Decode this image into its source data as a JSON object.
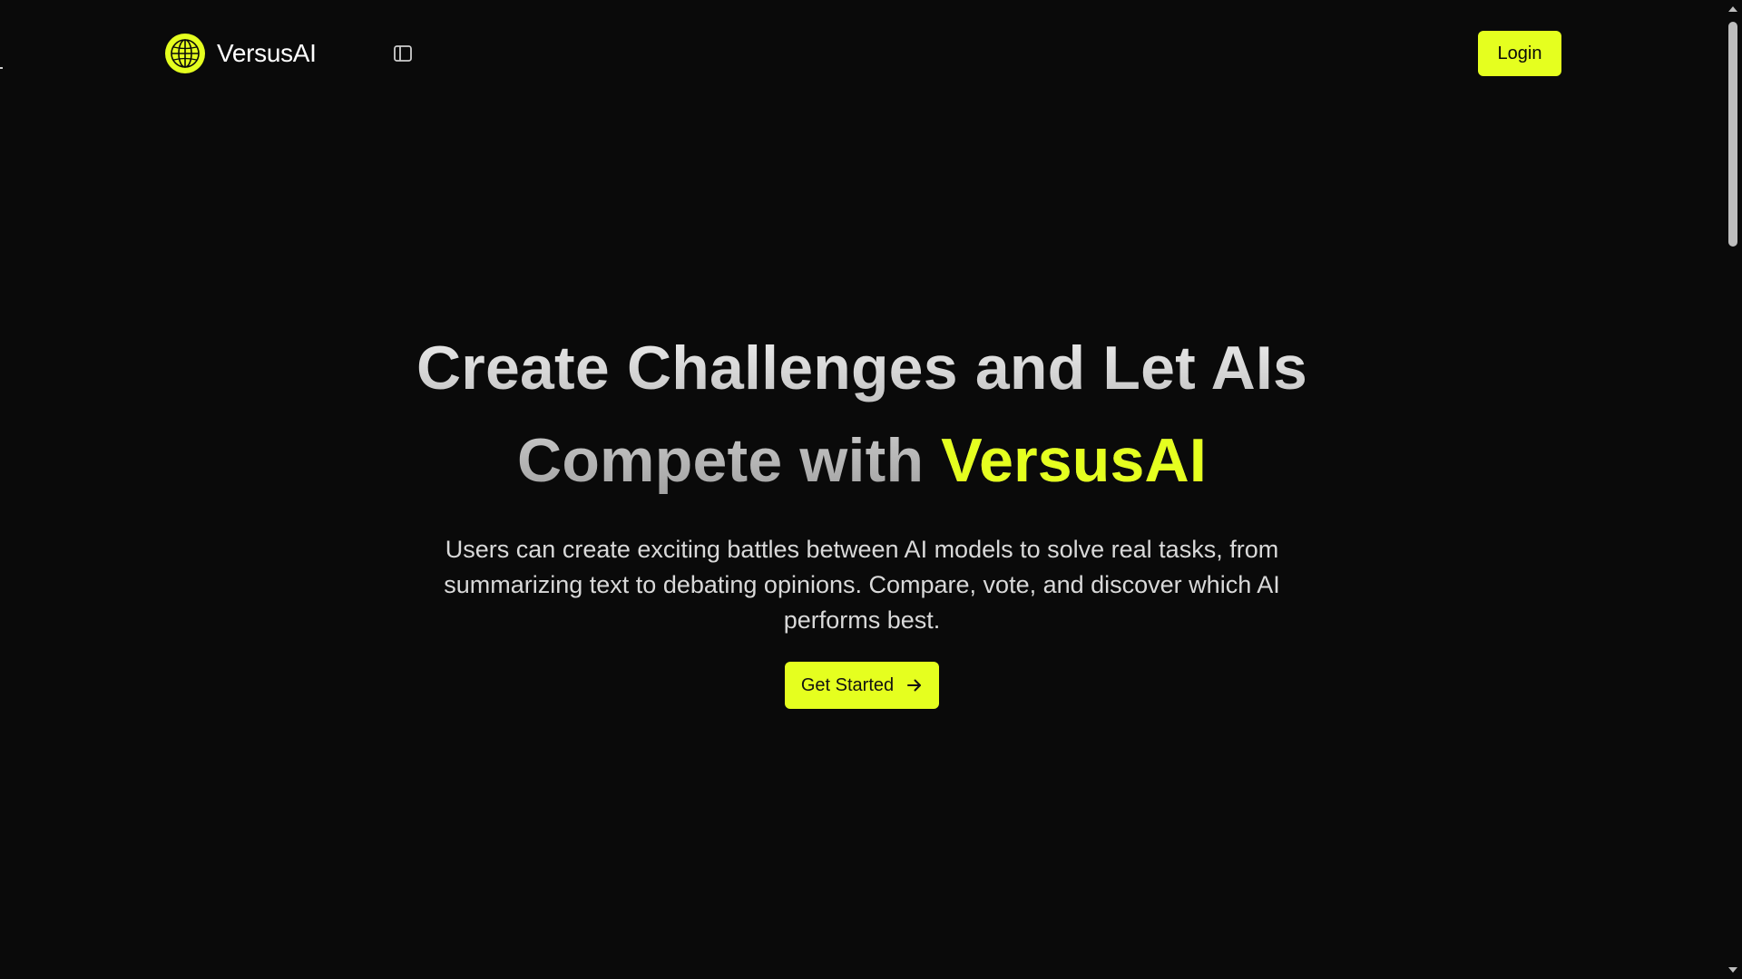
{
  "colors": {
    "background": "#0a0a0a",
    "accent": "#e5ff1f",
    "text": "#ffffff",
    "muted_text": "#d9d9d9"
  },
  "header": {
    "logo_icon": "globe-logo-icon",
    "brand_name": "VersusAI",
    "sidebar_toggle_icon": "sidebar-toggle-icon",
    "login_label": "Login"
  },
  "hero": {
    "title_line1": "Create Challenges and Let AIs",
    "title_line2_prefix": "Compete with ",
    "title_line2_accent": "VersusAI",
    "description": "Users can create exciting battles between AI models to solve real tasks, from summarizing text to debating opinions. Compare, vote, and discover which AI performs best.",
    "cta_label": "Get Started",
    "cta_icon": "arrow-right-icon"
  }
}
